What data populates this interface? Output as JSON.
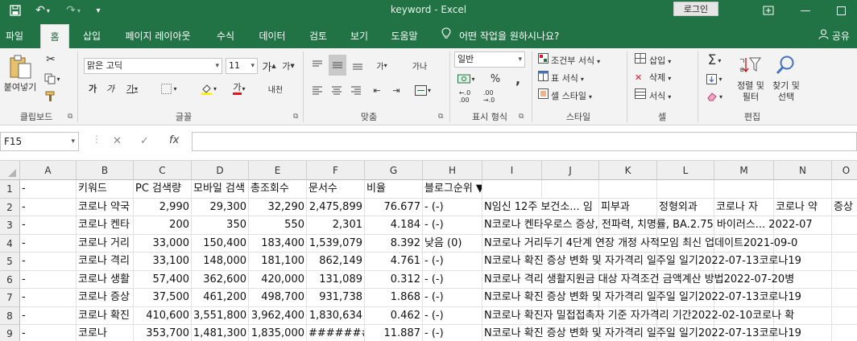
{
  "app": {
    "title": "keyword  -  Excel",
    "login_label": "로그인"
  },
  "tabs": [
    "파일",
    "홈",
    "삽입",
    "페이지 레이아웃",
    "수식",
    "데이터",
    "검토",
    "보기",
    "도움말"
  ],
  "tell_me": "어떤 작업을 원하시나요?",
  "share_label": "공유",
  "ribbon": {
    "paste_label": "붙여넣기",
    "font_name": "맑은 고딕",
    "font_size": "11",
    "number_format": "일반",
    "conditional_format": "조건부 서식",
    "table_format": "표 서식",
    "cell_style": "셀 스타일",
    "insert": "삽입",
    "delete": "삭제",
    "format": "서식",
    "sort_filter": "정렬 및\n필터",
    "find_select": "찾기 및\n선택",
    "groups": [
      "클립보드",
      "글꼴",
      "맞춤",
      "표시 형식",
      "스타일",
      "셀",
      "편집"
    ]
  },
  "formula_bar": {
    "name_box": "F15",
    "cancel_glyph": "✕",
    "enter_glyph": "✓",
    "fx_glyph": "fx",
    "formula": ""
  },
  "sheet": {
    "columns": [
      "A",
      "B",
      "C",
      "D",
      "E",
      "F",
      "G",
      "H",
      "I",
      "J",
      "K",
      "L",
      "M",
      "N",
      "O"
    ],
    "row_numbers": [
      "1",
      "2",
      "3",
      "4",
      "5",
      "6",
      "7",
      "8",
      "9"
    ],
    "rows": [
      [
        "-",
        "키워드",
        "PC 검색량",
        "모바일 검색",
        "총조회수",
        "문서수",
        "비율",
        "블로그순위 ▼",
        "",
        "",
        "",
        "",
        "",
        "",
        ""
      ],
      [
        "-",
        "코로나 약국",
        "2,990",
        "29,300",
        "32,290",
        "2,475,899",
        "76.677",
        "- (-)",
        "N임신 12주 보건소... 임",
        "",
        "피부과",
        "정형외과",
        "코로나 자",
        "코로나 약",
        "증상"
      ],
      [
        "-",
        "코로나 켄타",
        "200",
        "350",
        "550",
        "2,301",
        "4.184",
        "- (-)",
        "N코로나 켄타우로스 증상, 전파력, 치명률, BA.2.75 바이러스... 2022-07",
        "",
        "",
        "",
        "",
        "",
        ""
      ],
      [
        "-",
        "코로나 거리",
        "33,000",
        "150,400",
        "183,400",
        "1,539,079",
        "8.392",
        "낮음 (0)",
        "N코로나 거리두기 4단계 연장 개정 사적모임 최신 업데이트2021-09-0",
        "",
        "",
        "",
        "",
        "",
        ""
      ],
      [
        "-",
        "코로나 격리",
        "33,100",
        "148,000",
        "181,100",
        "862,149",
        "4.761",
        "- (-)",
        "N코로나 확진 증상 변화 및 자가격리 일주일 일기2022-07-13코로나19",
        "",
        "",
        "",
        "",
        "",
        ""
      ],
      [
        "-",
        "코로나 생활",
        "57,400",
        "362,600",
        "420,000",
        "131,089",
        "0.312",
        "- (-)",
        "N코로나 격리 생활지원금 대상 자격조건 금액계산 방법2022-07-20병",
        "",
        "",
        "",
        "",
        "",
        ""
      ],
      [
        "-",
        "코로나 증상",
        "37,500",
        "461,200",
        "498,700",
        "931,738",
        "1.868",
        "- (-)",
        "N코로나 확진 증상 변화 및 자가격리 일주일 일기2022-07-13코로나19",
        "",
        "",
        "",
        "",
        "",
        ""
      ],
      [
        "-",
        "코로나 확진",
        "410,600",
        "3,551,800",
        "3,962,400",
        "1,830,634",
        "0.462",
        "- (-)",
        "N코로나 확진자 밀접접촉자 기준 자가격리 기간2022-02-10코로나 확",
        "",
        "",
        "",
        "",
        "",
        ""
      ],
      [
        "-",
        "코로나",
        "353,700",
        "1,481,300",
        "1,835,000",
        "#######",
        "11.887",
        "- (-)",
        "N코로나 확진 증상 변화 및 자가격리 일주일 일기2022-07-13코로나19",
        "",
        "",
        "",
        "",
        "",
        ""
      ]
    ]
  },
  "colors": {
    "excel_green": "#217346",
    "ribbon_bg": "#f3f3f3",
    "header_bg": "#efefef",
    "grid_line": "#e1e1e1"
  }
}
